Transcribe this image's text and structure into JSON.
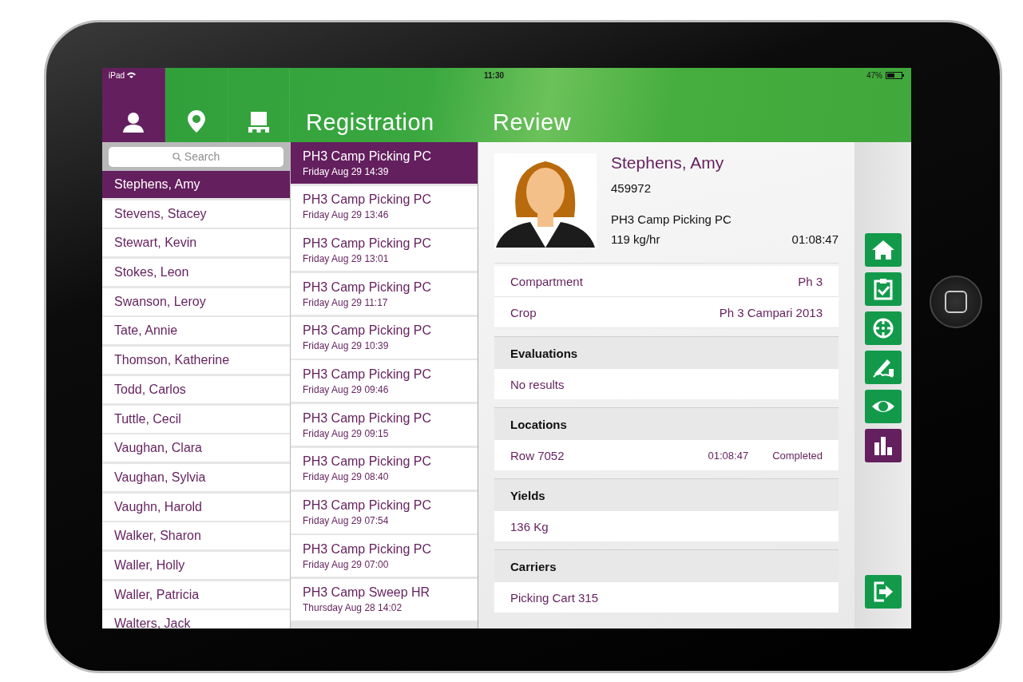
{
  "status_bar": {
    "device": "iPad",
    "time": "11:30",
    "battery": "47%"
  },
  "nav_tabs": [
    {
      "kind": "person",
      "selected": true
    },
    {
      "kind": "pin",
      "selected": false
    },
    {
      "kind": "pallet",
      "selected": false
    }
  ],
  "people": {
    "search_placeholder": "Search",
    "items": [
      {
        "name": "Stephens, Amy",
        "selected": true
      },
      {
        "name": "Stevens, Stacey",
        "selected": false
      },
      {
        "name": "Stewart, Kevin",
        "selected": false
      },
      {
        "name": "Stokes, Leon",
        "selected": false
      },
      {
        "name": "Swanson, Leroy",
        "selected": false
      },
      {
        "name": "Tate, Annie",
        "selected": false
      },
      {
        "name": "Thomson, Katherine",
        "selected": false
      },
      {
        "name": "Todd, Carlos",
        "selected": false
      },
      {
        "name": "Tuttle, Cecil",
        "selected": false
      },
      {
        "name": "Vaughan, Clara",
        "selected": false
      },
      {
        "name": "Vaughan, Sylvia",
        "selected": false
      },
      {
        "name": "Vaughn, Harold",
        "selected": false
      },
      {
        "name": "Walker, Sharon",
        "selected": false
      },
      {
        "name": "Waller, Holly",
        "selected": false
      },
      {
        "name": "Waller, Patricia",
        "selected": false
      },
      {
        "name": "Walters, Jack",
        "selected": false
      }
    ]
  },
  "sessions": {
    "title": "Registration",
    "items": [
      {
        "title": "PH3 Camp Picking PC",
        "time": "Friday Aug 29 14:39",
        "selected": true
      },
      {
        "title": "PH3 Camp Picking PC",
        "time": "Friday Aug 29 13:46",
        "selected": false
      },
      {
        "title": "PH3 Camp Picking PC",
        "time": "Friday Aug 29 13:01",
        "selected": false
      },
      {
        "title": "PH3 Camp Picking PC",
        "time": "Friday Aug 29 11:17",
        "selected": false
      },
      {
        "title": "PH3 Camp Picking PC",
        "time": "Friday Aug 29 10:39",
        "selected": false
      },
      {
        "title": "PH3 Camp Picking PC",
        "time": "Friday Aug 29 09:46",
        "selected": false
      },
      {
        "title": "PH3 Camp Picking PC",
        "time": "Friday Aug 29 09:15",
        "selected": false
      },
      {
        "title": "PH3 Camp Picking PC",
        "time": "Friday Aug 29 08:40",
        "selected": false
      },
      {
        "title": "PH3 Camp Picking PC",
        "time": "Friday Aug 29 07:54",
        "selected": false
      },
      {
        "title": "PH3 Camp Picking PC",
        "time": "Friday Aug 29 07:00",
        "selected": false
      },
      {
        "title": "PH3 Camp Sweep HR",
        "time": "Thursday Aug 28 14:02",
        "selected": false
      }
    ]
  },
  "review": {
    "title": "Review",
    "profile": {
      "name": "Stephens, Amy",
      "id": "459972",
      "session": "PH3 Camp Picking PC",
      "rate": "119 kg/hr",
      "duration": "01:08:47"
    },
    "details": [
      {
        "label": "Compartment",
        "value": "Ph 3"
      },
      {
        "label": "Crop",
        "value": "Ph 3 Campari 2013"
      }
    ],
    "sections": [
      {
        "heading": "Evaluations",
        "rows": [
          {
            "text": "No results"
          }
        ]
      },
      {
        "heading": "Locations",
        "rows": [
          {
            "text": "Row 7052",
            "time": "01:08:47",
            "status": "Completed"
          }
        ]
      },
      {
        "heading": "Yields",
        "rows": [
          {
            "text": "136 Kg"
          }
        ]
      },
      {
        "heading": "Carriers",
        "rows": [
          {
            "text": "Picking Cart 315"
          }
        ]
      }
    ]
  },
  "side_actions": [
    {
      "kind": "home",
      "selected": false
    },
    {
      "kind": "clipboard",
      "selected": false
    },
    {
      "kind": "target",
      "selected": false
    },
    {
      "kind": "sign",
      "selected": false
    },
    {
      "kind": "eye",
      "selected": false
    },
    {
      "kind": "chart",
      "selected": true
    },
    {
      "kind": "logout",
      "selected": false
    }
  ]
}
